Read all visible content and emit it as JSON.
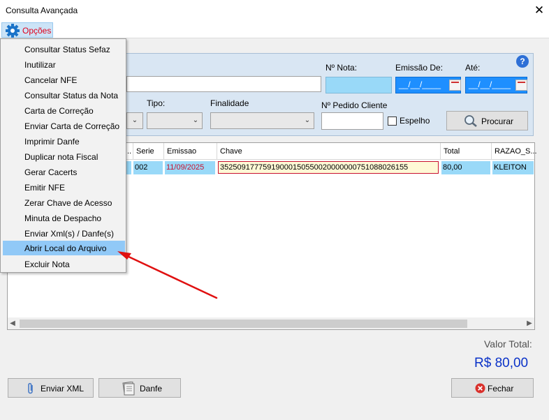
{
  "window": {
    "title": "Consulta Avançada"
  },
  "menubar": {
    "opcoes_label": "Opções"
  },
  "dropdown": {
    "items": [
      "Consultar Status Sefaz",
      "Inutilizar",
      "Cancelar NFE",
      "Consultar Status da Nota",
      "Carta de Correção",
      "Enviar Carta de Correção",
      "Imprimir Danfe",
      "Duplicar nota Fiscal",
      "Gerar Cacerts",
      "Emitir NFE",
      "Zerar Chave de Acesso",
      "Minuta de Despacho",
      "Enviar Xml(s) / Danfe(s)",
      "Abrir Local do Arquivo",
      "Excluir Nota"
    ],
    "highlighted_index": 13
  },
  "filters": {
    "nota_label": "Nº Nota:",
    "emissao_de_label": "Emissão De:",
    "ate_label": "Até:",
    "date_placeholder": "__/__/____",
    "tipo_label": "Tipo:",
    "finalidade_label": "Finalidade",
    "pedido_label": "Nº Pedido Cliente",
    "espelho_label": "Espelho",
    "procurar_label": "Procurar"
  },
  "grid": {
    "columns": [
      "..",
      "Serie",
      "Emissao",
      "Chave",
      "Total",
      "RAZAO_S..."
    ],
    "rows": [
      {
        "serie": "002",
        "emissao": "11/09/2025",
        "chave": "35250917775919000150550020000000751088026155",
        "total": "80,00",
        "razao": "KLEITON"
      }
    ]
  },
  "totals": {
    "label": "Valor Total:",
    "value": "R$ 80,00"
  },
  "footer": {
    "enviar_xml": "Enviar XML",
    "danfe": "Danfe",
    "fechar": "Fechar"
  },
  "colors": {
    "accent": "#0a32c8",
    "menu_label": "#e0001b",
    "highlight": "#91c9f7",
    "arrow": "#e01010"
  }
}
